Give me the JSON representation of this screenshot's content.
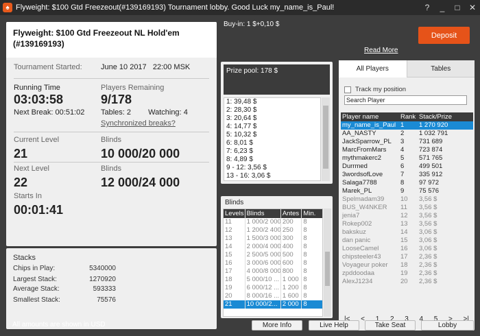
{
  "window": {
    "title": "Flyweight: $100 Gtd Freezeout(#139169193) Tournament lobby. Good Luck my_name_is_Paul!",
    "help": "?",
    "minimize": "_",
    "maximize": "□",
    "close": "✕"
  },
  "tournament": {
    "name": "Flyweight: $100 Gtd Freezeout NL Hold'em",
    "id": "(#139169193)",
    "started_label": "Tournament Started:",
    "started_value": "June 10 2017   22:00 MSK",
    "running_label": "Running Time",
    "running_value": "03:03:58",
    "next_break_label": "Next Break:",
    "next_break_value": "00:51:02",
    "players_label": "Players Remaining",
    "players_value": "9/178",
    "tables_label": "Tables:",
    "tables_value": "2",
    "watching_label": "Watching:",
    "watching_value": "4",
    "sync_breaks": "Synchronized breaks?",
    "current_level_label": "Current Level",
    "current_level_value": "21",
    "current_blinds_label": "Blinds",
    "current_blinds_value": "10 000/20 000",
    "next_level_label": "Next Level",
    "next_level_value": "22",
    "next_blinds_label": "Blinds",
    "next_blinds_value": "12 000/24 000",
    "starts_in_label": "Starts In",
    "starts_in_value": "00:01:41"
  },
  "stacks": {
    "title": "Stacks",
    "rows": [
      {
        "label": "Chips in Play:",
        "value": "5340000"
      },
      {
        "label": "Largest Stack:",
        "value": "1270920"
      },
      {
        "label": "Average Stack:",
        "value": "593333"
      },
      {
        "label": "Smallest Stack:",
        "value": "75576"
      }
    ]
  },
  "footnote": "All amounts are shown in USD",
  "buyin": "Buy-in: 1 $+0,10 $",
  "deposit_label": "Deposit",
  "read_more": "Read More",
  "prize": {
    "title": "Prize pool: 178 $",
    "rows": [
      "1: 39,48 $",
      "2: 28,30 $",
      "3: 20,64 $",
      "4: 14,77 $",
      "5: 10,32 $",
      "6: 8,01 $",
      "7: 6,23 $",
      "8: 4,89 $",
      "9 - 12: 3,56 $",
      "13 - 16: 3,06 $"
    ]
  },
  "blinds": {
    "title": "Blinds",
    "headers": [
      "Levels",
      "Blinds",
      "Antes",
      "Min."
    ],
    "rows": [
      [
        "11",
        "1 000/2 000",
        "200",
        "8"
      ],
      [
        "12",
        "1 200/2 400",
        "250",
        "8"
      ],
      [
        "13",
        "1 500/3 000",
        "300",
        "8"
      ],
      [
        "14",
        "2 000/4 000",
        "400",
        "8"
      ],
      [
        "15",
        "2 500/5 000",
        "500",
        "8"
      ],
      [
        "16",
        "3 000/6 000",
        "600",
        "8"
      ],
      [
        "17",
        "4 000/8 000",
        "800",
        "8"
      ],
      [
        "18",
        "5 000/10 ...",
        "1 000",
        "8"
      ],
      [
        "19",
        "6 000/12 ...",
        "1 200",
        "8"
      ],
      [
        "20",
        "8 000/16 ...",
        "1 600",
        "8"
      ],
      [
        "21",
        "10 000/2...",
        "2 000",
        "8"
      ]
    ],
    "selected_index": 10
  },
  "players": {
    "tab_all": "All Players",
    "tab_tables": "Tables",
    "track_label": "Track my position",
    "search_placeholder": "Search Player",
    "headers": [
      "Player name",
      "Rank",
      "Stack/Prize"
    ],
    "rows": [
      [
        "my_name_is_Paul",
        "1",
        "1 270 920"
      ],
      [
        "AA_NASTY",
        "2",
        "1 032 791"
      ],
      [
        "JackSparrow_PL",
        "3",
        "731 689"
      ],
      [
        "MarcFromMars",
        "4",
        "723 874"
      ],
      [
        "mythmakerc2",
        "5",
        "571 765"
      ],
      [
        "Durrmed",
        "6",
        "499 501"
      ],
      [
        "3wordsofLove",
        "7",
        "335 912"
      ],
      [
        "Salaga7788",
        "8",
        "97 972"
      ],
      [
        "Marek_PL",
        "9",
        "75 576"
      ],
      [
        "Spelmadam39",
        "10",
        "3,56 $"
      ],
      [
        "BUS_W4NKER",
        "11",
        "3,56 $"
      ],
      [
        "jenia7",
        "12",
        "3,56 $"
      ],
      [
        "Rokep002",
        "13",
        "3,56 $"
      ],
      [
        "bakskuz",
        "14",
        "3,06 $"
      ],
      [
        "dan panic",
        "15",
        "3,06 $"
      ],
      [
        "LooseCamel",
        "16",
        "3,06 $"
      ],
      [
        "chipsteeler43",
        "17",
        "2,36 $"
      ],
      [
        "Voyageur poker",
        "18",
        "2,36 $"
      ],
      [
        "zpddoodaa",
        "19",
        "2,36 $"
      ],
      [
        "AlexJ1234",
        "20",
        "2,36 $"
      ]
    ],
    "selected_index": 0,
    "active_count": 9,
    "pages": [
      "1",
      "2",
      "3",
      "4",
      "5"
    ],
    "first": "|<",
    "prev": "<",
    "next": ">",
    "last": ">|"
  },
  "buttons": {
    "more_info": "More Info",
    "live_help": "Live Help",
    "take_seat": "Take Seat",
    "lobby": "Lobby"
  }
}
